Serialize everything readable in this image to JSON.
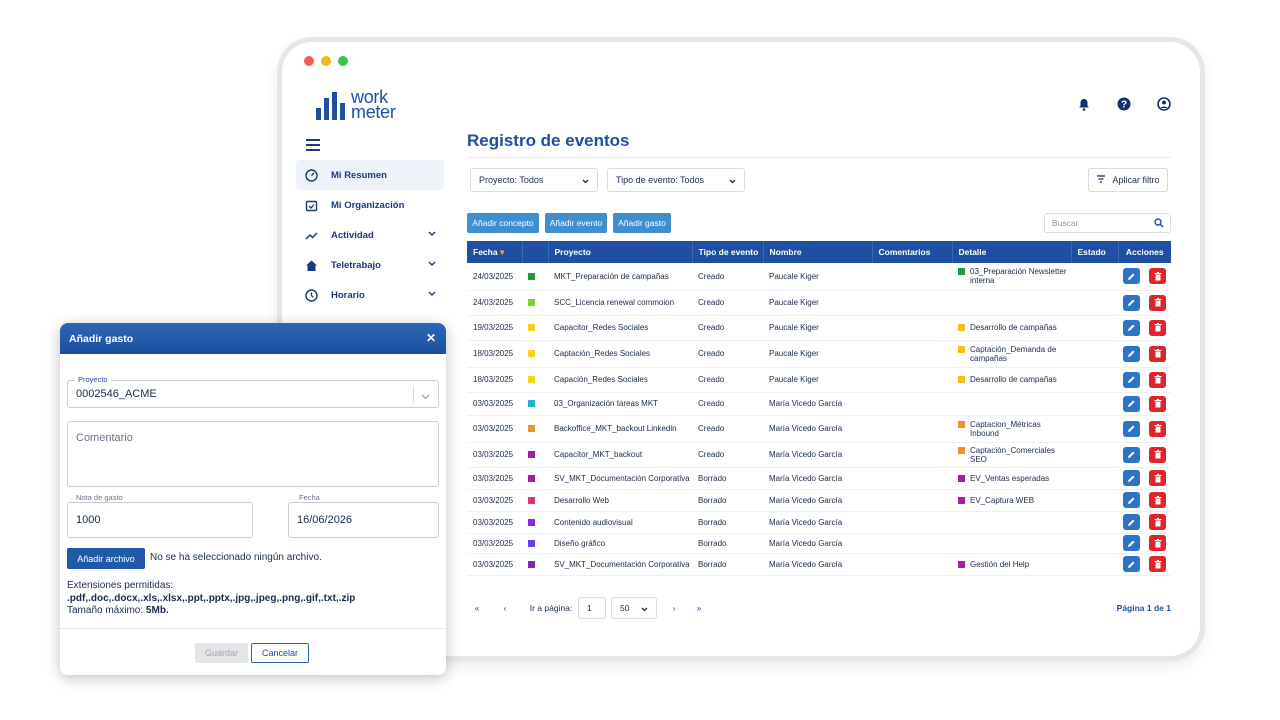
{
  "brand": {
    "line1": "work",
    "line2": "meter"
  },
  "colors": {
    "primary": "#1f4fa3",
    "button": "#3f8fcf",
    "delete": "#e0242b",
    "edit": "#2c72c6"
  },
  "window_dots": [
    "#f25c54",
    "#f5b524",
    "#3ec44c"
  ],
  "top_icons": [
    "bell-icon",
    "help-icon",
    "user-icon"
  ],
  "sidebar": {
    "items": [
      {
        "label": "Mi Resumen",
        "icon": "gauge-icon"
      },
      {
        "label": "Mi Organización",
        "icon": "calendar-check-icon"
      },
      {
        "label": "Actividad",
        "icon": "trend-icon"
      },
      {
        "label": "Teletrabajo",
        "icon": "home-icon"
      },
      {
        "label": "Horario",
        "icon": "clock-icon"
      }
    ]
  },
  "page": {
    "title": "Registro de eventos"
  },
  "filters": {
    "proyecto": "Proyecto: Todos",
    "tipo": "Tipo de evento: Todos",
    "apply": "Aplicar filtro"
  },
  "actions": {
    "concepto": "Añadir concepto",
    "evento": "Añadir evento",
    "gasto": "Añadir gasto"
  },
  "search": {
    "placeholder": "Buscar"
  },
  "table": {
    "headers": [
      "Fecha",
      "",
      "Proyecto",
      "Tipo de evento",
      "Nombre",
      "Comentarios",
      "Detalle",
      "Estado",
      "Acciones"
    ],
    "rows": [
      {
        "fecha": "24/03/2025",
        "color": "#1e9e3a",
        "proyecto": "MKT_Preparación de campañas",
        "tipo": "Creado",
        "nombre": "Paucale Kiger",
        "detalle": "03_Preparación Newsletter interna",
        "det_color": "#1e9e3a"
      },
      {
        "fecha": "24/03/2025",
        "color": "#7ed321",
        "proyecto": "SCC_Licencia renewal commoion",
        "tipo": "Creado",
        "nombre": "Paucale Kiger",
        "detalle": "",
        "det_color": ""
      },
      {
        "fecha": "19/03/2025",
        "color": "#f0d61a",
        "proyecto": "Capacitor_Redes Sociales",
        "tipo": "Creado",
        "nombre": "Paucale Kiger",
        "detalle": "Desarrollo de campañas",
        "det_color": "#f0c21a"
      },
      {
        "fecha": "18/03/2025",
        "color": "#f0d61a",
        "proyecto": "Captación_Redes Sociales",
        "tipo": "Creado",
        "nombre": "Paucale Kiger",
        "detalle": "Captación_Demanda de campañas",
        "det_color": "#f0c21a"
      },
      {
        "fecha": "18/03/2025",
        "color": "#f0d61a",
        "proyecto": "Capación_Redes Sociales",
        "tipo": "Creado",
        "nombre": "Paucale Kiger",
        "detalle": "Desarrollo de campañas",
        "det_color": "#f0c21a"
      },
      {
        "fecha": "03/03/2025",
        "color": "#1fb5d6",
        "proyecto": "03_Organización tareas MKT",
        "tipo": "Creado",
        "nombre": "María Vicedo García",
        "detalle": "",
        "det_color": ""
      },
      {
        "fecha": "03/03/2025",
        "color": "#f0932a",
        "proyecto": "Backoffice_MKT_backout Linkedin",
        "tipo": "Creado",
        "nombre": "María Vicedo García",
        "detalle": "Captacion_Métricas Inbound",
        "det_color": "#f0932a"
      },
      {
        "fecha": "03/03/2025",
        "color": "#a31f9e",
        "proyecto": "Capacitor_MKT_backout",
        "tipo": "Creado",
        "nombre": "María Vicedo García",
        "detalle": "Captación_Comerciales SEO",
        "det_color": "#f0932a"
      },
      {
        "fecha": "03/03/2025",
        "color": "#a31f9e",
        "proyecto": "SV_MKT_Documentación Corporativa",
        "tipo": "Borrado",
        "nombre": "María Vicedo García",
        "detalle": "EV_Ventas esperadas",
        "det_color": "#a31f9e"
      },
      {
        "fecha": "03/03/2025",
        "color": "#e8336c",
        "proyecto": "Desarrollo Web",
        "tipo": "Borrado",
        "nombre": "María Vicedo García",
        "detalle": "EV_Captura WEB",
        "det_color": "#a31f9e"
      },
      {
        "fecha": "03/03/2025",
        "color": "#8a2be2",
        "proyecto": "Contenido audiovisual",
        "tipo": "Borrado",
        "nombre": "María Vicedo García",
        "detalle": "",
        "det_color": ""
      },
      {
        "fecha": "03/03/2025",
        "color": "#6a3de8",
        "proyecto": "Diseño gráfico",
        "tipo": "Borrado",
        "nombre": "María Vicedo García",
        "detalle": "",
        "det_color": ""
      },
      {
        "fecha": "03/03/2025",
        "color": "#7a2bb0",
        "proyecto": "SV_MKT_Documentación Corporativa",
        "tipo": "Borrado",
        "nombre": "María Vicedo García",
        "detalle": "Gestión del Help",
        "det_color": "#a31f9e"
      }
    ]
  },
  "pager": {
    "goto_label": "Ir a página:",
    "page_value": "1",
    "per_page": "50",
    "summary": "Página 1 de 1"
  },
  "modal": {
    "title": "Añadir gasto",
    "proyecto_label": "Proyecto",
    "proyecto_value": "0002546_ACME",
    "comentario_placeholder": "Comentario",
    "nota_label": "Nota de gasto",
    "nota_value": "1000",
    "fecha_label": "Fecha",
    "fecha_value": "16/06/2026",
    "file_button": "Añadir archivo",
    "file_status": "No se ha seleccionado ningún archivo.",
    "ext_label": "Extensiones permitidas:",
    "ext_list": ".pdf,.doc,.docx,.xls,.xlsx,.ppt,.pptx,.jpg,.jpeg,.png,.gif,.txt,.zip",
    "max_label": "Tamaño máximo:",
    "max_value": "5Mb.",
    "save": "Guardar",
    "cancel": "Cancelar"
  }
}
